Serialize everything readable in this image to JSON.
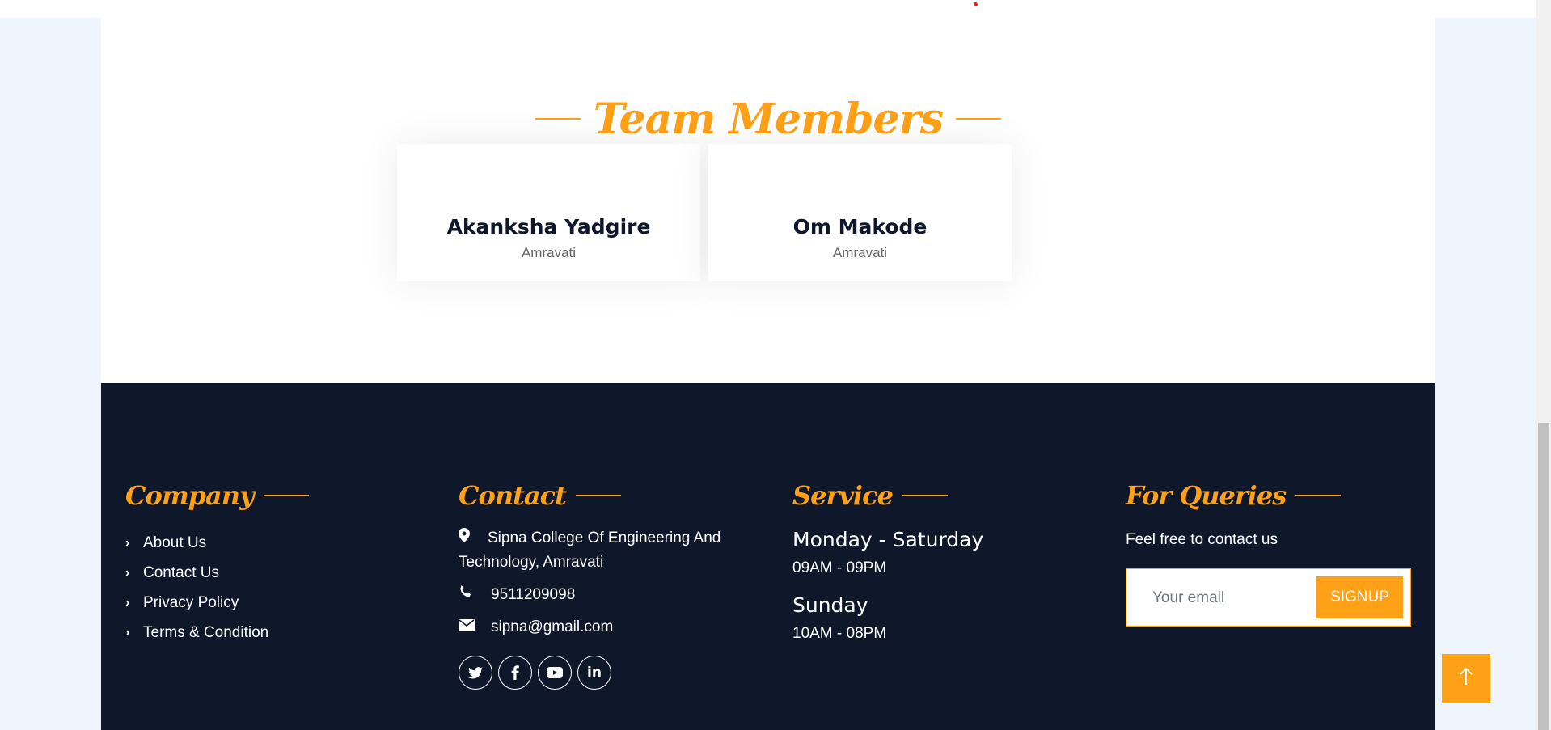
{
  "team": {
    "title": "Team Members",
    "members": [
      {
        "name": "Akanksha Yadgire",
        "location": "Amravati"
      },
      {
        "name": "Om Makode",
        "location": "Amravati"
      }
    ]
  },
  "footer": {
    "company": {
      "title": "Company",
      "links": [
        "About Us",
        "Contact Us",
        "Privacy Policy",
        "Terms & Condition"
      ]
    },
    "contact": {
      "title": "Contact",
      "address": "Sipna College Of Engineering And Technology, Amravati",
      "phone": "9511209098",
      "email": "sipna@gmail.com",
      "socials": [
        "twitter-icon",
        "facebook-icon",
        "youtube-icon",
        "linkedin-icon"
      ]
    },
    "service": {
      "title": "Service",
      "days1": "Monday - Saturday",
      "hours1": "09AM - 09PM",
      "days2": "Sunday",
      "hours2": "10AM - 08PM"
    },
    "queries": {
      "title": "For Queries",
      "text": "Feel free to contact us",
      "email_placeholder": "Your email",
      "button_label": "SIGNUP"
    }
  },
  "colors": {
    "accent": "#fea116",
    "footer_bg": "#0f172b",
    "page_bg": "#eef5fd"
  }
}
